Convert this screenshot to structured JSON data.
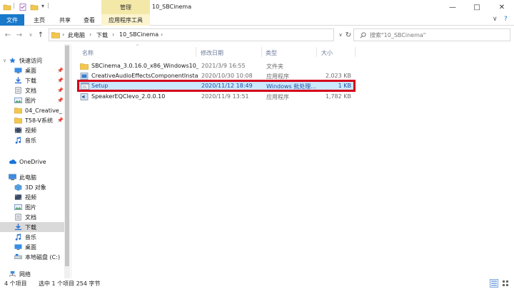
{
  "window": {
    "title": "10_SBCinema",
    "context_tab_header": "管理",
    "controls": {
      "minimize": "—",
      "maximize": "□",
      "close": "✕"
    }
  },
  "ribbon": {
    "tabs": [
      {
        "label": "文件"
      },
      {
        "label": "主页"
      },
      {
        "label": "共享"
      },
      {
        "label": "查看"
      },
      {
        "label": "应用程序工具"
      }
    ],
    "expand_glyph": "∨",
    "help_glyph": "?"
  },
  "address": {
    "back": "←",
    "forward": "→",
    "recent": "∨",
    "up": "↑",
    "breadcrumbs": [
      "此电脑",
      "下载",
      "10_SBCinema"
    ],
    "dropdown": "∨",
    "refresh": "↻",
    "search_placeholder": "搜索\"10_SBCinema\""
  },
  "nav": {
    "quick_access": "快速访问",
    "quick_items": [
      {
        "label": "桌面",
        "icon": "desktop"
      },
      {
        "label": "下载",
        "icon": "download"
      },
      {
        "label": "文档",
        "icon": "document"
      },
      {
        "label": "图片",
        "icon": "picture"
      },
      {
        "label": "04_Creative_",
        "icon": "folder"
      },
      {
        "label": "T58-V系统",
        "icon": "folder"
      },
      {
        "label": "视频",
        "icon": "video"
      },
      {
        "label": "音乐",
        "icon": "music"
      }
    ],
    "onedrive": "OneDrive",
    "this_pc": "此电脑",
    "pc_items": [
      {
        "label": "3D 对象",
        "icon": "3d"
      },
      {
        "label": "视频",
        "icon": "video"
      },
      {
        "label": "图片",
        "icon": "picture"
      },
      {
        "label": "文档",
        "icon": "document"
      },
      {
        "label": "下载",
        "icon": "download"
      },
      {
        "label": "音乐",
        "icon": "music"
      },
      {
        "label": "桌面",
        "icon": "desktop"
      },
      {
        "label": "本地磁盘 (C:)",
        "icon": "drive"
      },
      {
        "label": "网络",
        "icon": "network"
      }
    ]
  },
  "columns": {
    "name": "名称",
    "date": "修改日期",
    "type": "类型",
    "size": "大小"
  },
  "files": [
    {
      "name": "SBCinema_3.0.16.0_x86_Windows10_P...",
      "date": "2021/3/9 16:55",
      "type": "文件夹",
      "size": "",
      "icon": "folder"
    },
    {
      "name": "CreativeAudioEffectsComponentInsta...",
      "date": "2020/10/30 10:08",
      "type": "应用程序",
      "size": "2,023 KB",
      "icon": "app"
    },
    {
      "name": "Setup",
      "date": "2020/11/12 18:49",
      "type": "Windows 批处理...",
      "size": "1 KB",
      "icon": "batch",
      "selected": true
    },
    {
      "name": "SpeakerEQClevo_2.0.0.10",
      "date": "2020/11/9 13:51",
      "type": "应用程序",
      "size": "1,782 KB",
      "icon": "app"
    }
  ],
  "status": {
    "count": "4 个项目",
    "selection": "选中 1 个项目  254 字节"
  },
  "colors": {
    "file_tab": "#1979ca",
    "context_header": "#f4e8a8",
    "selection": "#cce8ff",
    "highlight_border": "#d4001b",
    "folder": "#f3c74f"
  }
}
